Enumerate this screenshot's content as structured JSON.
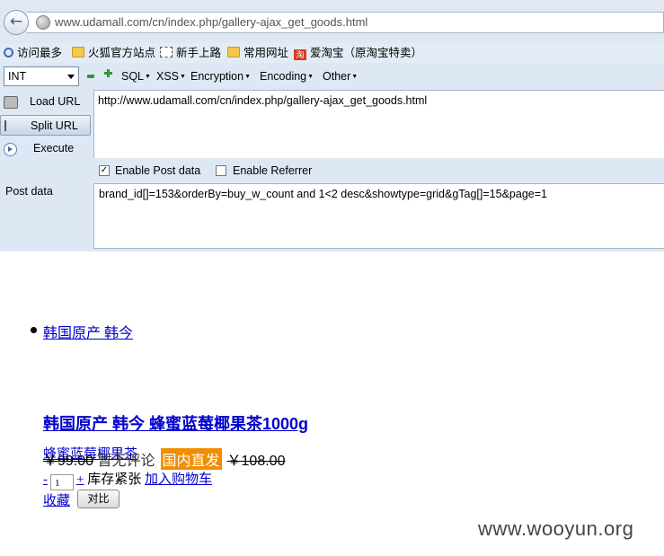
{
  "browser": {
    "url": "www.udamall.com/cn/index.php/gallery-ajax_get_goods.html"
  },
  "bookmarks": [
    {
      "label": "访问最多",
      "icon": "search-icon"
    },
    {
      "label": "火狐官方站点",
      "icon": "folder-icon"
    },
    {
      "label": "新手上路",
      "icon": "dashed-box-icon"
    },
    {
      "label": "常用网址",
      "icon": "folder-icon"
    },
    {
      "label": "爱淘宝（原淘宝特卖）",
      "icon": "taobao-icon"
    }
  ],
  "hackbar": {
    "type_select": "INT",
    "menus": [
      "SQL",
      "XSS",
      "Encryption",
      "Encoding",
      "Other"
    ],
    "buttons": {
      "load_url": "Load URL",
      "split_url": "Split URL",
      "execute": "Execute"
    },
    "url_value": "http://www.udamall.com/cn/index.php/gallery-ajax_get_goods.html",
    "enable_post": {
      "label": "Enable Post data",
      "checked": "✓"
    },
    "enable_referrer": {
      "label": "Enable Referrer",
      "checked": ""
    },
    "post_label": "Post data",
    "post_value": "brand_id[]=153&orderBy=buy_w_count  and 1<2 desc&showtype=grid&gTag[]=15&page=1"
  },
  "page": {
    "brand_link": "韩国原产 韩今",
    "product_title": "韩国原产 韩今 蜂蜜蓝莓椰果茶1000g",
    "short_name": "蜂蜜蓝莓椰果茶",
    "price": "￥99.00",
    "review": "暂无评论",
    "badge": "国内直发",
    "old_price": "￥108.00",
    "qty_minus": "-",
    "qty_value": "1",
    "qty_plus": "+",
    "stock": "库存紧张",
    "add_cart": "加入购物车",
    "favorite": "收藏",
    "compare": "对比"
  },
  "watermark": "www.wooyun.org",
  "colors": {
    "badge": "#f18d00",
    "link": "#0000cc"
  }
}
